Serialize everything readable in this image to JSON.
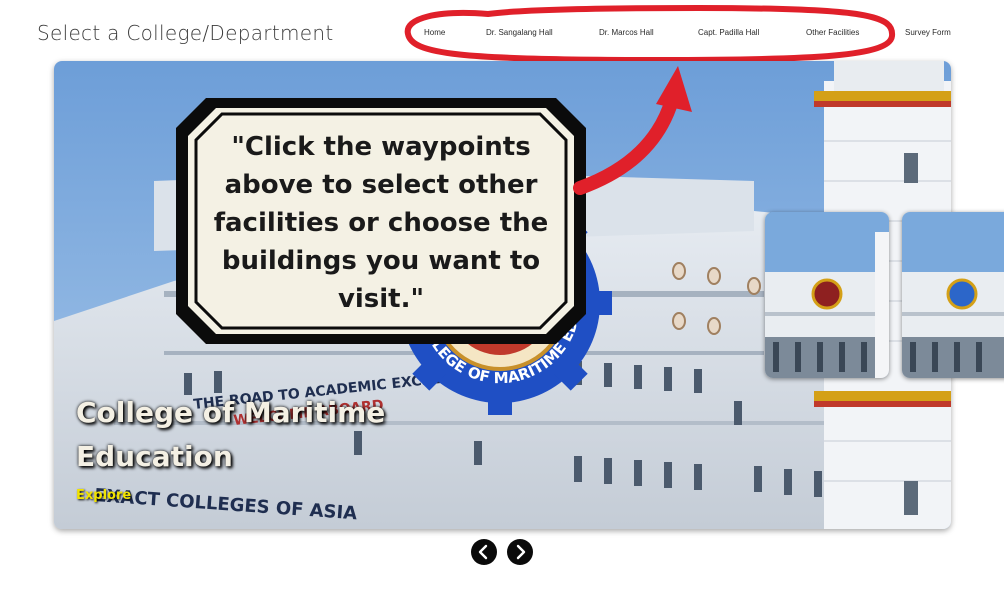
{
  "page": {
    "title": "Select a College/Department"
  },
  "nav": {
    "items": [
      "Home",
      "Dr. Sangalang Hall",
      "Dr. Marcos Hall",
      "Capt. Padilla Hall",
      "Other Facilities",
      "Survey Form"
    ]
  },
  "slide": {
    "title": "College of Maritime Education",
    "link": "Explore",
    "badge_text": "COLLEGE OF MARITIME EDUCATION",
    "ship_sign_1": "THE ROAD TO ACADEMIC EXCELLENCE...",
    "ship_sign_2": "WELCOME ABOARD",
    "ship_sign_3": "EXACT COLLEGES OF ASIA"
  },
  "callout": {
    "text": "\"Click the waypoints above to select other facilities or choose the buildings you want to visit.\""
  },
  "colors": {
    "highlight": "#e0202a",
    "callout_bg": "#efebdc",
    "link": "#f1e300"
  },
  "icons": {
    "prev": "chevron-left-icon",
    "next": "chevron-right-icon"
  }
}
